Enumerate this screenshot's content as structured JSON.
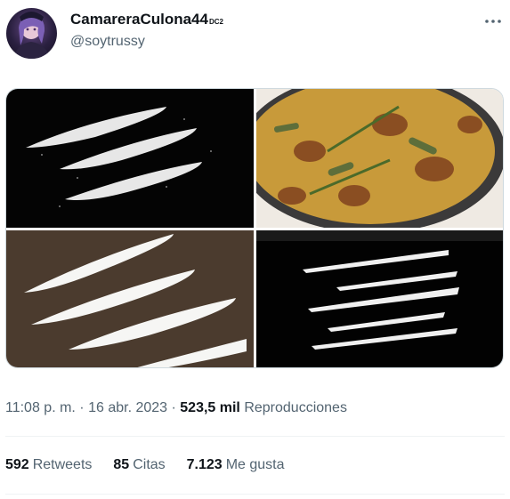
{
  "author": {
    "display_name": "CamareraCulona44",
    "badge": "DC2",
    "handle": "@soytrussy"
  },
  "icons": {
    "more": "more-horizontal-icon"
  },
  "media": {
    "images": [
      "cocaine-lines-black",
      "paella-pan",
      "cocaine-lines-brown",
      "cocaine-lines-dark"
    ]
  },
  "meta": {
    "time": "11:08 p. m.",
    "sep1": " · ",
    "date": "16 abr. 2023",
    "sep2": " · ",
    "views_count": "523,5 mil",
    "views_label": "Reproducciones"
  },
  "stats": {
    "retweets_count": "592",
    "retweets_label": "Retweets",
    "quotes_count": "85",
    "quotes_label": "Citas",
    "likes_count": "7.123",
    "likes_label": "Me gusta"
  },
  "colors": {
    "text_primary": "#0f1419",
    "text_secondary": "#536471",
    "divider": "#eff3f4"
  }
}
